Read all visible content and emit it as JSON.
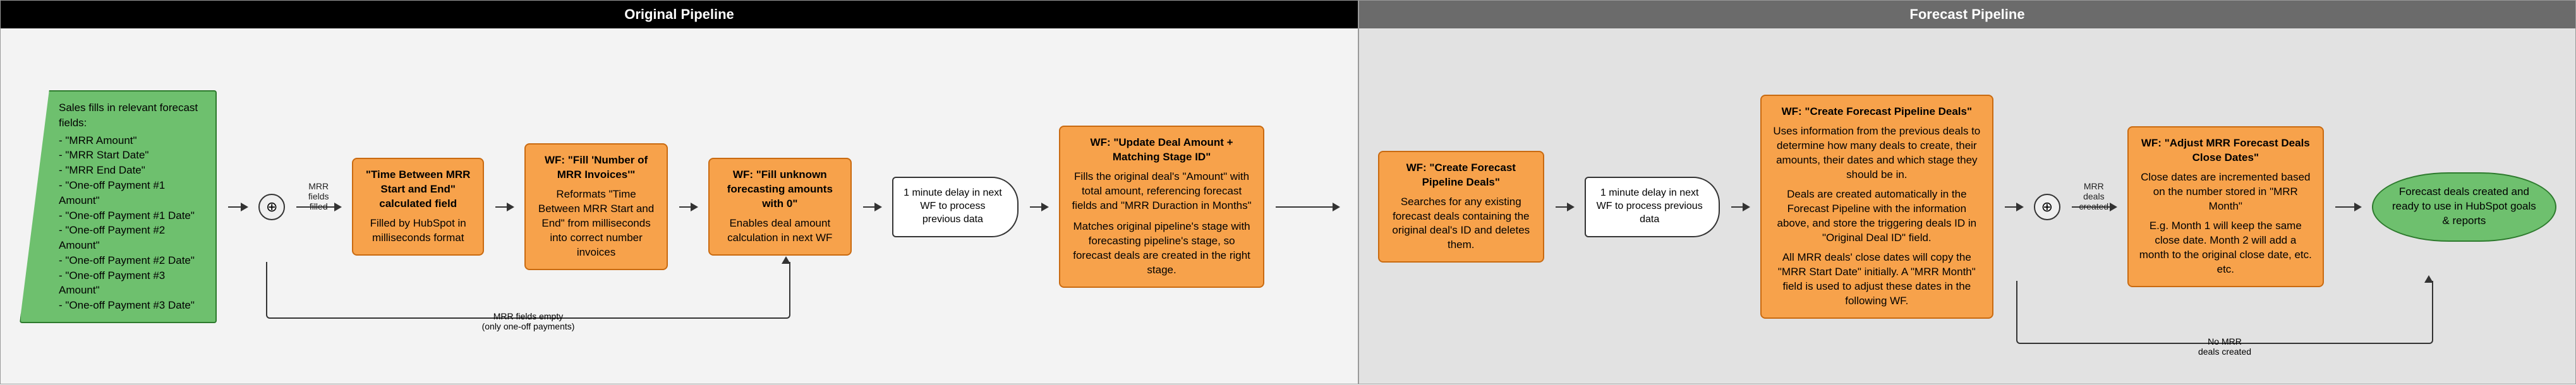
{
  "panes": {
    "original": {
      "title": "Original Pipeline"
    },
    "forecast": {
      "title": "Forecast Pipeline"
    }
  },
  "start": {
    "title": "Sales fills in relevant forecast fields:",
    "fields": [
      "\"MRR Amount\"",
      "\"MRR Start Date\"",
      "\"MRR End Date\"",
      "\"One-off Payment #1 Amount\"",
      "\"One-off Payment #1 Date\"",
      "\"One-off Payment #2 Amount\"",
      "\"One-off Payment #2 Date\"",
      "\"One-off Payment #3 Amount\"",
      "\"One-off Payment #3 Date\""
    ]
  },
  "nodes": {
    "calc_time": {
      "title": "\"Time Between MRR Start and End\" calculated field",
      "body": "Filled by HubSpot in milliseconds format"
    },
    "wf_num_invoices": {
      "title": "WF: \"Fill 'Number of MRR Invoices'\"",
      "body": "Reformats \"Time Between MRR Start and End\" from milliseconds into correct number invoices"
    },
    "wf_fill_zero": {
      "title": "WF: \"Fill unknown forecasting amounts with 0\"",
      "body": "Enables deal amount calculation in next WF"
    },
    "wf_update_deal": {
      "title": "WF: \"Update Deal Amount + Matching Stage ID\"",
      "body1": "Fills the original deal's \"Amount\" with total amount, referencing forecast fields and \"MRR Duraction in Months\"",
      "body2": "Matches original pipeline's stage with forecasting pipeline's stage, so forecast deals are created in the right stage."
    },
    "wf_create_forecast": {
      "title": "WF: \"Create Forecast Pipeline Deals\"",
      "body": "Searches for any existing forecast deals containing the original deal's ID and deletes them."
    },
    "wf_create_forecast_deals": {
      "title": "WF: \"Create Forecast Pipeline Deals\"",
      "body1": "Uses information from the previous deals to determine how many deals to create, their amounts, their dates and which stage they should be in.",
      "body2": "Deals are created automatically in the Forecast Pipeline with the information above, and store the triggering deals ID in \"Original Deal ID\" field.",
      "body3": "All MRR deals' close dates will copy the \"MRR Start Date\" initially. A \"MRR Month\" field is used to adjust these dates in the following WF."
    },
    "wf_adjust_close": {
      "title": "WF: \"Adjust MRR Forecast Deals Close Dates\"",
      "body1": "Close dates are incremented based on the number stored in \"MRR Month\"",
      "body2": "E.g. Month 1 will keep the same close date. Month 2 will add a month to the original close date, etc. etc."
    }
  },
  "delays": {
    "d1": "1 minute delay in next WF to process previous data",
    "d2": "1 minute delay in next WF to process previous data"
  },
  "labels": {
    "mrr_filled": "MRR fields\nfilled",
    "mrr_empty": "MRR fields empty\n(only one-off payments)",
    "mrr_created": "MRR deals\ncreated",
    "no_mrr": "No MRR\ndeals created"
  },
  "end": {
    "text": "Forecast deals created and ready to use in HubSpot goals & reports"
  }
}
